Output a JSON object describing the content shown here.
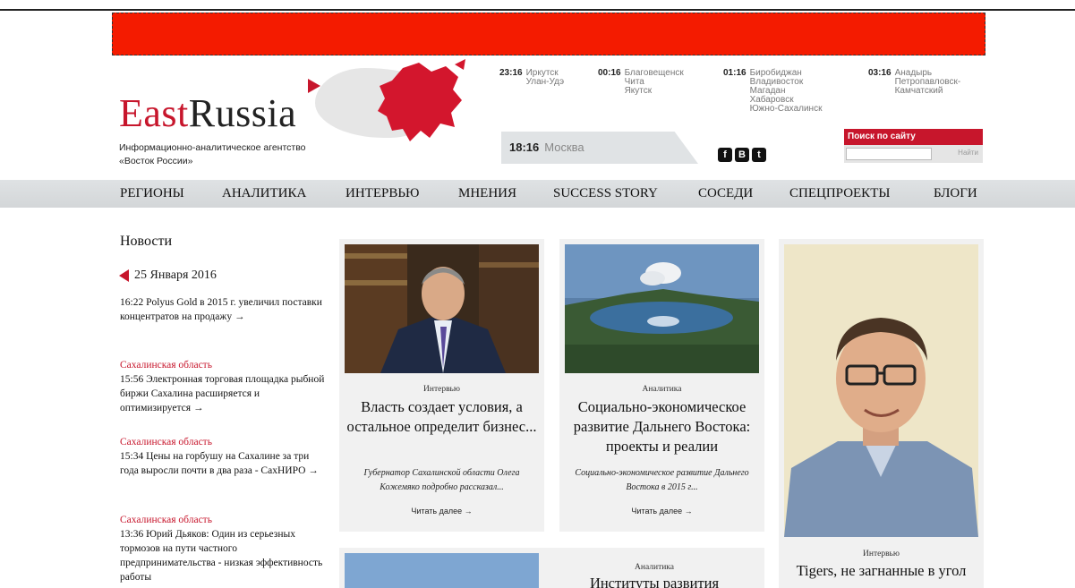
{
  "header": {
    "logo_east": "East",
    "logo_russia": "Russia",
    "tagline_line1": "Информационно-аналитическое агентство",
    "tagline_line2": "«Восток России»",
    "timezones": [
      {
        "time": "23:16",
        "cities": [
          "Иркутск",
          "Улан-Удэ"
        ]
      },
      {
        "time": "00:16",
        "cities": [
          "Благовещенск",
          "Чита",
          "Якутск"
        ]
      },
      {
        "time": "01:16",
        "cities": [
          "Биробиджан",
          "Владивосток",
          "Магадан",
          "Хабаровск",
          "Южно-Сахалинск"
        ]
      },
      {
        "time": "03:16",
        "cities": [
          "Анадырь",
          "Петропавловск-",
          "Камчатский"
        ]
      }
    ],
    "moscow_time": "18:16",
    "moscow_city": "Москва",
    "social": {
      "facebook": "f",
      "vk": "B",
      "twitter": "t"
    },
    "search_label": "Поиск по сайту",
    "search_button": "Найти",
    "search_value": ""
  },
  "nav": [
    "РЕГИОНЫ",
    "АНАЛИТИКА",
    "ИНТЕРВЬЮ",
    "МНЕНИЯ",
    "SUCCESS STORY",
    "СОСЕДИ",
    "СПЕЦПРОЕКТЫ",
    "БЛОГИ"
  ],
  "sidebar": {
    "title": "Новости",
    "date": "25 Января 2016",
    "items": [
      {
        "region": "",
        "text": "16:22 Polyus Gold в 2015 г. увеличил поставки концентратов на продажу →"
      },
      {
        "region": "Сахалинская область",
        "text": "15:56 Электронная торговая площадка рыбной биржи Сахалина расширяется и оптимизируется →"
      },
      {
        "region": "Сахалинская область",
        "text": "15:34 Цены на горбушу на Сахалине за три года выросли почти в два раза - СахНИРО →"
      },
      {
        "region": "Сахалинская область",
        "text": "13:36 Юрий Дьяков: Один из серьезных тормозов на пути частного предпринимательства - низкая эффективность работы"
      }
    ]
  },
  "cards": [
    {
      "category": "Интервью",
      "title": "Власть создает условия, а остальное определит бизнес...",
      "lead": "Губернатор Сахалинской области Олега Кожемяко подробно рассказал...",
      "more": "Читать далее →"
    },
    {
      "category": "Аналитика",
      "title": "Социально-экономическое развитие Дальнего Востока: проекты и реалии",
      "lead": "Социально-экономическое развитие Дальнего Востока в 2015 г...",
      "more": "Читать далее →"
    },
    {
      "category": "Интервью",
      "title": "Tigers, не загнанные в угол"
    },
    {
      "category": "Аналитика",
      "title": "Институты развития"
    }
  ],
  "colors": {
    "brand_red": "#c7162c",
    "ad_red": "#f41b00",
    "nav_gray": "#d8dbdd"
  }
}
